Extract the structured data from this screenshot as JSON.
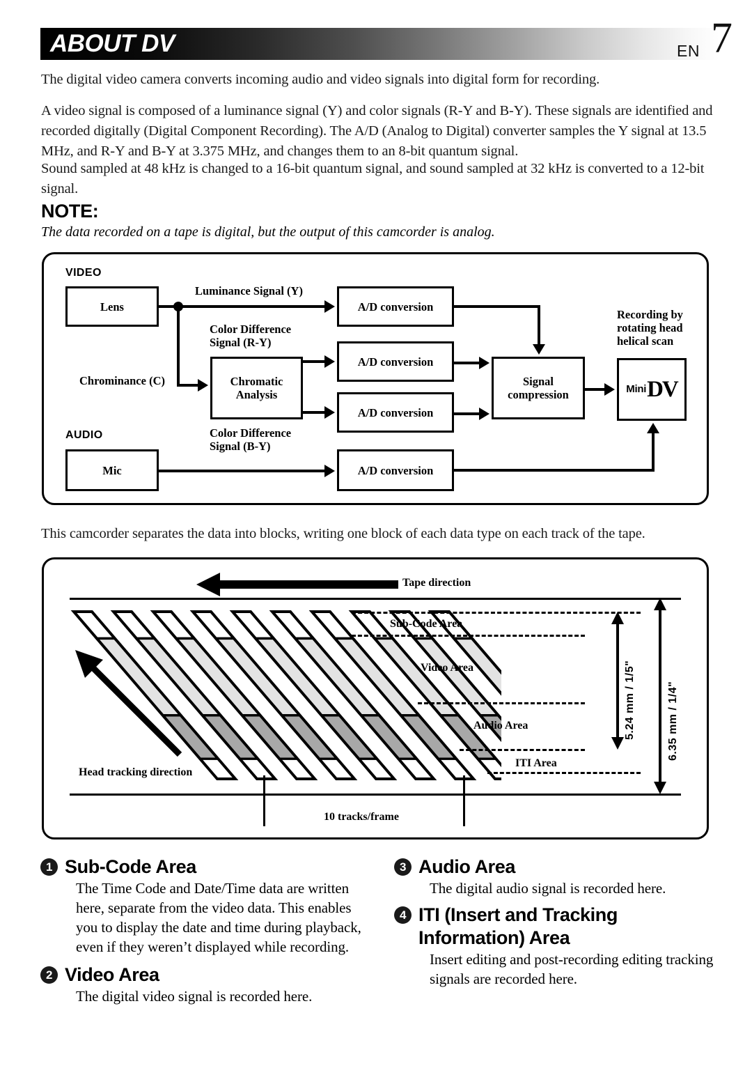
{
  "header": {
    "title": "ABOUT DV",
    "lang": "EN",
    "page_number": "7"
  },
  "body": {
    "intro": "The digital video camera converts incoming audio and video signals into digital form for recording.",
    "video_signal": "A video signal is composed of a luminance signal (Y) and color signals (R-Y and B-Y). These signals are identified and recorded digitally (Digital Component Recording). The A/D (Analog to Digital) converter samples the Y signal at 13.5 MHz, and R-Y and B-Y at 3.375 MHz, and changes them to an 8-bit quantum signal.",
    "sound": "Sound sampled at 48 kHz is changed to a 16-bit quantum signal, and sound sampled at 32 kHz is converted to a 12-bit signal.",
    "blocks": "This camcorder separates the data into blocks, writing one block of each data type on each track of the tape."
  },
  "note": {
    "heading": "NOTE:",
    "text": "The data recorded on a tape is digital, but the output of this camcorder is analog."
  },
  "block_diagram": {
    "section_video": "VIDEO",
    "section_audio": "AUDIO",
    "boxes": {
      "lens": "Lens",
      "mic": "Mic",
      "chromatic_analysis": "Chromatic\nAnalysis",
      "ad_y": "A/D\nconversion",
      "ad_ry": "A/D\nconversion",
      "ad_by": "A/D\nconversion",
      "ad_audio": "A/D\nconversion",
      "signal_compression": "Signal\ncompression"
    },
    "labels": {
      "luminance": "Luminance Signal (Y)",
      "color_diff_ry": "Color Difference\nSignal (R-Y)",
      "chrominance": "Chrominance (C)",
      "color_diff_by": "Color Difference\nSignal (B-Y)",
      "recording": "Recording by\nrotating head\nhelical scan"
    },
    "dv_logo": {
      "mini": "Mini",
      "mark": "DV"
    }
  },
  "tape_diagram": {
    "tape_direction": "Tape direction",
    "head_tracking": "Head tracking direction",
    "tracks_per_frame": "10 tracks/frame",
    "areas": {
      "sub_code": "Sub-Code Area",
      "video": "Video Area",
      "audio": "Audio Area",
      "iti": "ITI Area"
    },
    "dimensions": {
      "inner": "5.24 mm / 1/5\"",
      "outer": "6.35 mm / 1/4\""
    },
    "track_count": 10,
    "colors": {
      "sub_code": "#ffffff",
      "video": "#e3e3e3",
      "audio": "#a8a8a8",
      "iti": "#ffffff"
    }
  },
  "legend": {
    "items": [
      {
        "number": "1",
        "title": "Sub-Code Area",
        "body": "The Time Code and Date/Time data are written here, separate from the video data. This enables you to display the date and time during playback, even if they weren’t displayed while recording."
      },
      {
        "number": "2",
        "title": "Video Area",
        "body": "The digital video signal is recorded here."
      },
      {
        "number": "3",
        "title": "Audio Area",
        "body": "The digital audio signal is recorded here."
      },
      {
        "number": "4",
        "title": "ITI (Insert and Tracking Information) Area",
        "body": "Insert editing and post-recording editing tracking signals are recorded here."
      }
    ]
  }
}
